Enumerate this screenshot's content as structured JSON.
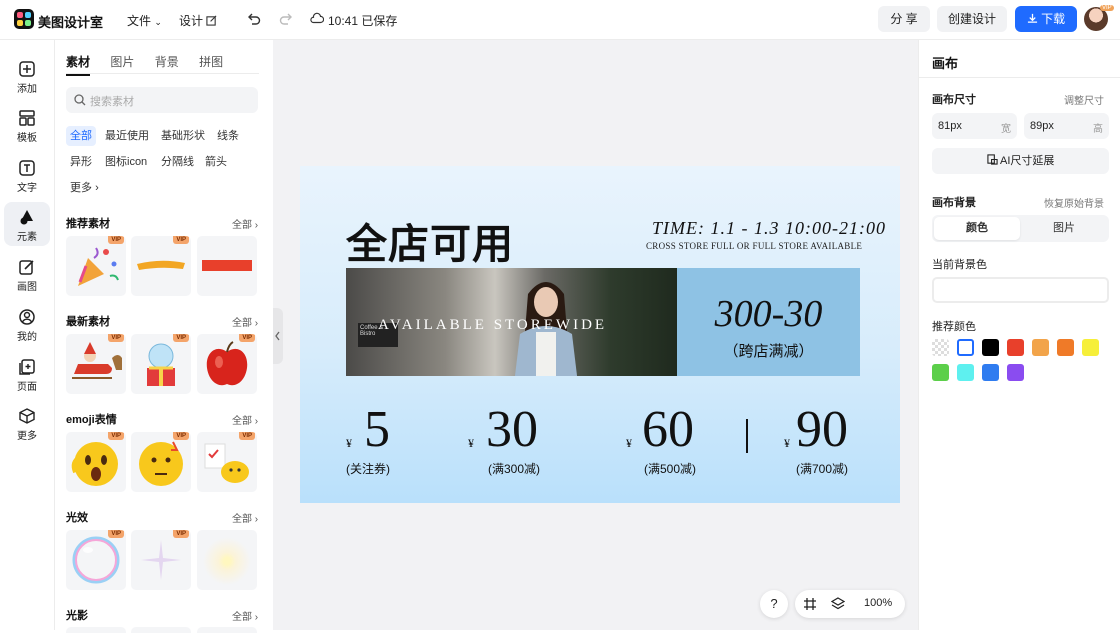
{
  "topbar": {
    "brand": "美图设计室",
    "menu_file": "文件",
    "menu_design": "设计",
    "save_status": "10:41 已保存",
    "share_label": "分 享",
    "create_label": "创建设计",
    "download_label": "下载",
    "avatar_badge": "VIP"
  },
  "leftnav": {
    "items": [
      {
        "label": "添加",
        "icon": "plus-square-icon"
      },
      {
        "label": "模板",
        "icon": "template-icon"
      },
      {
        "label": "文字",
        "icon": "text-icon"
      },
      {
        "label": "元素",
        "icon": "shapes-icon"
      },
      {
        "label": "画图",
        "icon": "pencil-icon"
      },
      {
        "label": "我的",
        "icon": "user-icon"
      },
      {
        "label": "页面",
        "icon": "page-add-icon"
      },
      {
        "label": "更多",
        "icon": "cube-icon"
      }
    ]
  },
  "panel": {
    "tabs": [
      "素材",
      "图片",
      "背景",
      "拼图"
    ],
    "search_placeholder": "搜索素材",
    "chips": [
      "全部",
      "最近使用",
      "基础形状",
      "线条",
      "异形",
      "图标icon",
      "分隔线",
      "箭头",
      "更多"
    ],
    "sections": [
      {
        "title": "推荐素材",
        "more": "全部"
      },
      {
        "title": "最新素材",
        "more": "全部"
      },
      {
        "title": "emoji表情",
        "more": "全部"
      },
      {
        "title": "光效",
        "more": "全部"
      },
      {
        "title": "光影",
        "more": "全部"
      }
    ],
    "vip_label": "VIP"
  },
  "artwork": {
    "title": "全店可用",
    "time": "TIME: 1.1 - 1.3   10:00-21:00",
    "subtitle": "CROSS STORE FULL OR FULL STORE AVAILABLE",
    "photo_text": "AVAILABLE STOREWIDE",
    "photo_sign": "Coffee & Bistro",
    "offer_main": "300-30",
    "offer_sub": "（跨店满减）",
    "coupons": [
      {
        "yen": "¥",
        "amount": "5",
        "note": "(关注券)"
      },
      {
        "yen": "¥",
        "amount": "30",
        "note": "(满300减)"
      },
      {
        "yen": "¥",
        "amount": "60",
        "note": "(满500减)"
      },
      {
        "yen": "¥",
        "amount": "90",
        "note": "(满700减)"
      }
    ]
  },
  "floatbar": {
    "help": "?",
    "zoom": "100%"
  },
  "rpanel": {
    "title": "画布",
    "size_label": "画布尺寸",
    "resize_link": "调整尺寸",
    "width_value": "81px",
    "width_unit": "宽",
    "height_value": "89px",
    "height_unit": "高",
    "ai_expand": "AI尺寸延展",
    "bg_label": "画布背景",
    "restore_link": "恢复原始背景",
    "seg_color": "颜色",
    "seg_image": "图片",
    "current_bg_label": "当前背景色",
    "recommended_label": "推荐颜色",
    "swatches": [
      "transparent",
      "#ffffff",
      "#000000",
      "#e8402b",
      "#f2a44a",
      "#ef7a28",
      "#f6ef3a",
      "#5ccf4a",
      "#5ef0ef",
      "#2f7cf0",
      "#8a4cf0"
    ]
  }
}
